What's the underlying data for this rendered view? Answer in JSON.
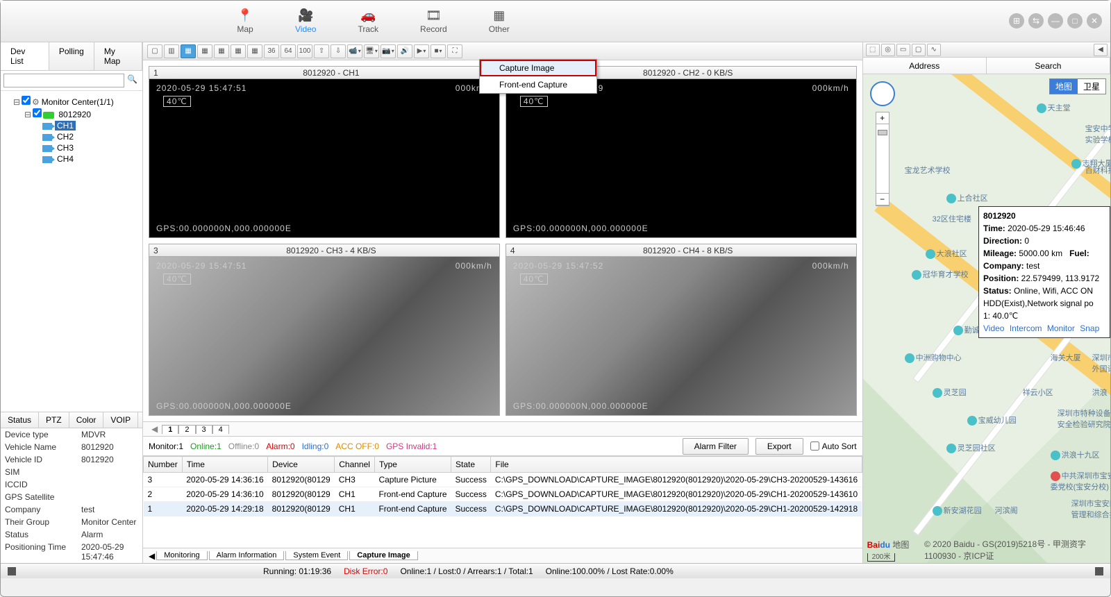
{
  "nav": {
    "map": "Map",
    "video": "Video",
    "track": "Track",
    "record": "Record",
    "other": "Other"
  },
  "left_tabs": {
    "dev": "Dev List",
    "polling": "Polling",
    "mymap": "My Map"
  },
  "tree": {
    "root": "Monitor Center(1/1)",
    "device": "8012920",
    "ch1": "CH1",
    "ch2": "CH2",
    "ch3": "CH3",
    "ch4": "CH4"
  },
  "lb_tabs": {
    "status": "Status",
    "ptz": "PTZ",
    "color": "Color",
    "voip": "VOIP"
  },
  "dev_info": [
    {
      "k": "Device type",
      "v": "MDVR"
    },
    {
      "k": "Vehicle Name",
      "v": "8012920"
    },
    {
      "k": "Vehicle ID",
      "v": "8012920"
    },
    {
      "k": "SIM",
      "v": ""
    },
    {
      "k": "ICCID",
      "v": ""
    },
    {
      "k": "GPS Satellite",
      "v": ""
    },
    {
      "k": "Company",
      "v": "test"
    },
    {
      "k": "Their Group",
      "v": "Monitor Center"
    },
    {
      "k": "Status",
      "v": "Alarm"
    },
    {
      "k": "Positioning Time",
      "v": "2020-05-29 15:47:46"
    }
  ],
  "ctx": {
    "capture": "Capture Image",
    "front": "Front-end Capture"
  },
  "videos": [
    {
      "n": "1",
      "title": "8012920 - CH1",
      "ts": "2020-05-29 15:47:51",
      "temp": "40℃",
      "spd": "000km/h",
      "gps": "GPS:00.000000N,000.000000E",
      "gray": false
    },
    {
      "n": "2",
      "title": "8012920 - CH2 - 0 KB/S",
      "ts": "2020-05-29 15:47:49",
      "temp": "40℃",
      "spd": "000km/h",
      "gps": "GPS:00.000000N,000.000000E",
      "gray": false
    },
    {
      "n": "3",
      "title": "8012920 - CH3 - 4 KB/S",
      "ts": "2020-05-29 15:47:51",
      "temp": "40℃",
      "spd": "000km/h",
      "gps": "GPS:00.000000N,000.000000E",
      "gray": true
    },
    {
      "n": "4",
      "title": "8012920 - CH4 - 8 KB/S",
      "ts": "2020-05-29 15:47:52",
      "temp": "40℃",
      "spd": "000km/h",
      "gps": "GPS:00.000000N,000.000000E",
      "gray": true
    }
  ],
  "page_tabs": [
    "1",
    "2",
    "3",
    "4"
  ],
  "monitor_bar": {
    "monitor": "Monitor:1",
    "online": "Online:1",
    "offline": "Offline:0",
    "alarm": "Alarm:0",
    "idling": "Idling:0",
    "accoff": "ACC OFF:0",
    "gpsinv": "GPS Invalid:1",
    "alarm_filter": "Alarm Filter",
    "export": "Export",
    "autosort": "Auto Sort"
  },
  "table": {
    "headers": [
      "Number",
      "Time",
      "Device",
      "Channel",
      "Type",
      "State",
      "File"
    ],
    "rows": [
      [
        "3",
        "2020-05-29 14:36:16",
        "8012920(80129",
        "CH3",
        "Capture Picture",
        "Success",
        "C:\\GPS_DOWNLOAD\\CAPTURE_IMAGE\\8012920(8012920)\\2020-05-29\\CH3-20200529-143616"
      ],
      [
        "2",
        "2020-05-29 14:36:10",
        "8012920(80129",
        "CH1",
        "Front-end Capture",
        "Success",
        "C:\\GPS_DOWNLOAD\\CAPTURE_IMAGE\\8012920(8012920)\\2020-05-29\\CH1-20200529-143610"
      ],
      [
        "1",
        "2020-05-29 14:29:18",
        "8012920(80129",
        "CH1",
        "Front-end Capture",
        "Success",
        "C:\\GPS_DOWNLOAD\\CAPTURE_IMAGE\\8012920(8012920)\\2020-05-29\\CH1-20200529-142918"
      ]
    ]
  },
  "bottom_tabs": {
    "monitoring": "Monitoring",
    "alarm": "Alarm Information",
    "sys": "System Event",
    "capture": "Capture Image"
  },
  "map": {
    "address": "Address",
    "search": "Search",
    "layer_map": "地图",
    "layer_sat": "卫星",
    "device": "8012920",
    "info": {
      "id": "8012920",
      "time_k": "Time:",
      "time_v": "2020-05-29 15:46:46",
      "dir_k": "Direction:",
      "dir_v": "0",
      "mil_k": "Mileage:",
      "mil_v": "5000.00 km",
      "fuel_k": "Fuel:",
      "co_k": "Company:",
      "co_v": "test",
      "pos_k": "Position:",
      "pos_v": "22.579499, 113.9172",
      "st_k": "Status:",
      "st_v": "Online, Wifi, ACC ON",
      "st2": "HDD(Exist),Network signal po",
      "t1": "1: 40.0℃",
      "links": {
        "video": "Video",
        "intercom": "Intercom",
        "monitor": "Monitor",
        "snap": "Snap"
      }
    },
    "scale": "200米",
    "attrib": "© 2020 Baidu - GS(2019)5218号 - 甲测资字1100930 - 京ICP证"
  },
  "footer": {
    "running": "Running: 01:19:36",
    "disk": "Disk Error:0",
    "online": "Online:1 / Lost:0 / Arrears:1 / Total:1",
    "rate": "Online:100.00% / Lost Rate:0.00%"
  }
}
